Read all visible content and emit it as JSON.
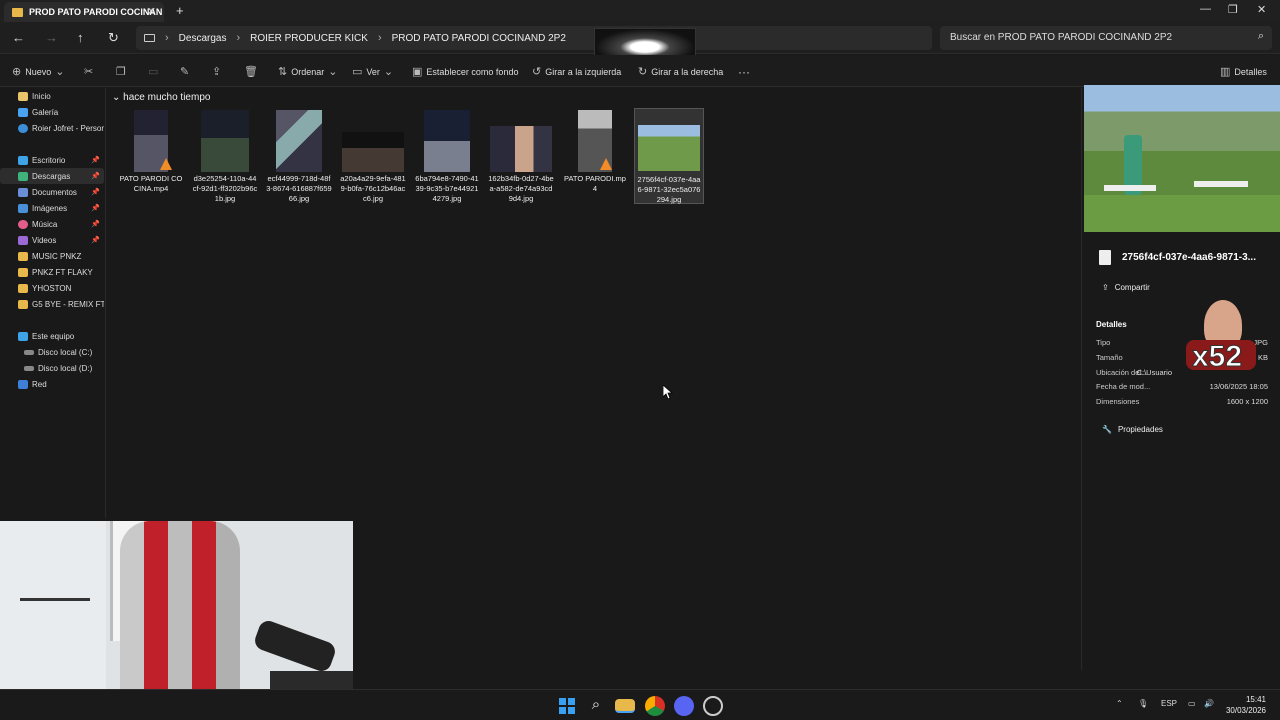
{
  "window": {
    "tab_title": "PROD PATO PARODI COCINAN",
    "new_tab": "+"
  },
  "breadcrumb": [
    "Descargas",
    "ROIER PRODUCER KICK",
    "PROD PATO PARODI COCINAND 2P2"
  ],
  "search": {
    "placeholder": "Buscar en PROD PATO PARODI COCINAND 2P2"
  },
  "toolbar": {
    "new": "Nuevo",
    "sort": "Ordenar",
    "view": "Ver",
    "set_background": "Establecer como fondo",
    "rotate_left": "Girar a la izquierda",
    "rotate_right": "Girar a la derecha",
    "more": "···",
    "details": "Detalles"
  },
  "sidebar": {
    "top": [
      {
        "label": "Inicio",
        "icon": "home-icon"
      },
      {
        "label": "Galería",
        "icon": "gallery-icon"
      },
      {
        "label": "Roier Jofret - Persona",
        "icon": "cloud-icon"
      }
    ],
    "pinned": [
      {
        "label": "Escritorio",
        "icon": "desktop-icon",
        "pinned": true
      },
      {
        "label": "Descargas",
        "icon": "download-icon",
        "pinned": true,
        "selected": true
      },
      {
        "label": "Documentos",
        "icon": "documents-icon",
        "pinned": true
      },
      {
        "label": "Imágenes",
        "icon": "pictures-icon",
        "pinned": true
      },
      {
        "label": "Música",
        "icon": "music-icon",
        "pinned": true
      },
      {
        "label": "Videos",
        "icon": "videos-icon",
        "pinned": true
      },
      {
        "label": "MUSIC PNKZ",
        "icon": "folder-icon"
      },
      {
        "label": "PNKZ FT FLAKY",
        "icon": "folder-icon"
      },
      {
        "label": "YHOSTON",
        "icon": "folder-icon"
      },
      {
        "label": "G5 BYE - REMIX FT K",
        "icon": "folder-icon"
      }
    ],
    "devices": [
      {
        "label": "Este equipo",
        "icon": "pc-icon"
      },
      {
        "label": "Disco local (C:)",
        "icon": "drive-icon"
      },
      {
        "label": "Disco local (D:)",
        "icon": "drive-icon"
      },
      {
        "label": "Red",
        "icon": "network-icon"
      }
    ]
  },
  "content": {
    "group_label": "hace mucho tiempo",
    "files": [
      {
        "name": "PATO PARODI COCINA.mp4",
        "kind": "video"
      },
      {
        "name": "d3e25254-110a-44cf-92d1-ff3202b96c1b.jpg",
        "kind": "image"
      },
      {
        "name": "ecf44999-718d-48f3-8674-616887f65966.jpg",
        "kind": "image"
      },
      {
        "name": "a20a4a29-9efa-4819-b0fa-76c12b46acc6.jpg",
        "kind": "image"
      },
      {
        "name": "6ba794e8-7490-4139-9c35-b7e449214279.jpg",
        "kind": "image"
      },
      {
        "name": "162b34fb-0d27-4bea-a582-de74a93cd9d4.jpg",
        "kind": "image"
      },
      {
        "name": "PATO PARODI.mp4",
        "kind": "video"
      },
      {
        "name": "2756f4cf-037e-4aa6-9871-32ec5a076294.jpg",
        "kind": "image",
        "selected": true
      }
    ]
  },
  "details_pane": {
    "filename": "2756f4cf-037e-4aa6-9871-3...",
    "share": "Compartir",
    "heading": "Detalles",
    "rows": [
      {
        "label": "Tipo",
        "value": "...JPG"
      },
      {
        "label": "Tamaño",
        "value": "KB"
      },
      {
        "label": "Ubicación del...",
        "value": "C:\\Usuario"
      },
      {
        "label": "Fecha de mod...",
        "value": "13/06/2025 18:05"
      },
      {
        "label": "Dimensiones",
        "value": "1600 x 1200"
      }
    ],
    "properties": "Propiedades"
  },
  "overlay": {
    "badge": "x52"
  },
  "taskbar": {
    "lang": "ESP",
    "time": "15:41",
    "date": "30/03/2026"
  },
  "colors": {
    "folder": "#e8b84a",
    "accent": "#4aa3f0",
    "background": "#191919"
  }
}
